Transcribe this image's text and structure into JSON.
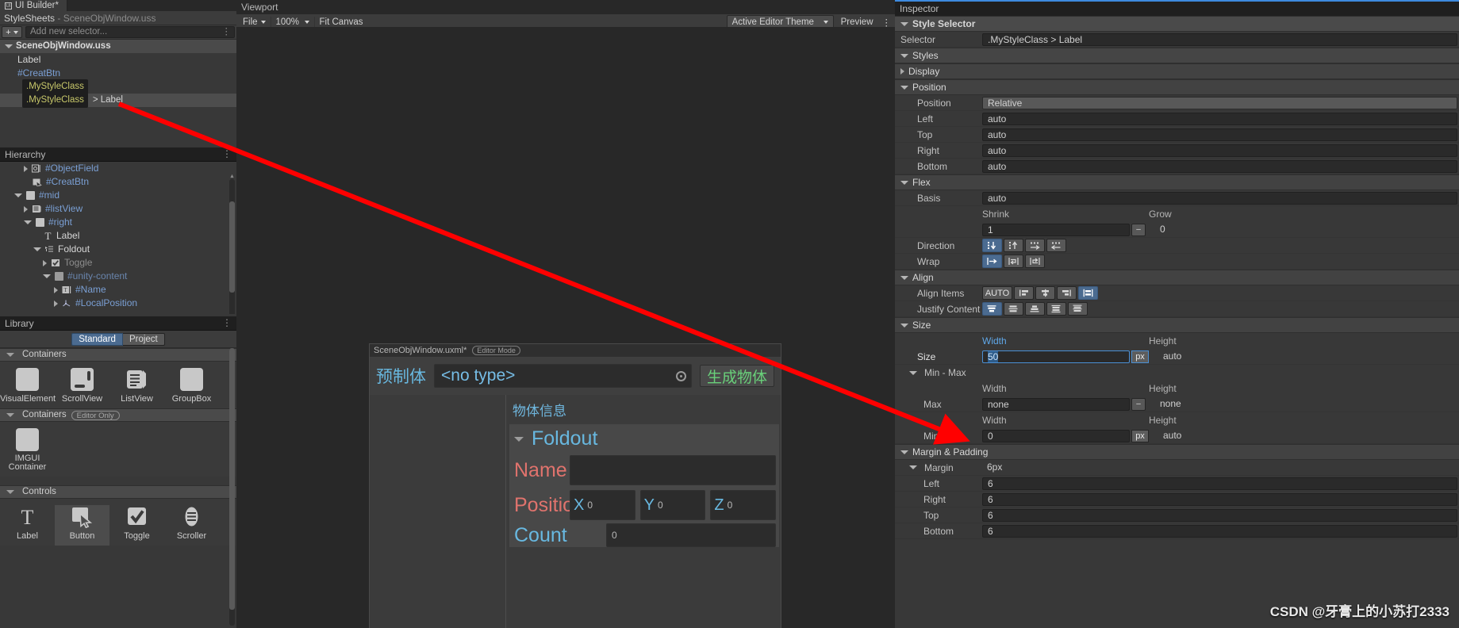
{
  "window": {
    "tab_label": "UI Builder*",
    "tab_icon": "ui-builder-icon"
  },
  "stylesheets": {
    "title": "StyleSheets",
    "subtitle": "- SceneObjWindow.uss",
    "add_button": "+",
    "selector_placeholder": "Add new selector...",
    "root": "SceneObjWindow.uss",
    "rows": [
      {
        "label": "Label",
        "kind": "plain"
      },
      {
        "label": "#CreatBtn",
        "kind": "id"
      },
      {
        "label": ".MyStyleClass",
        "kind": "class"
      },
      {
        "label": ".MyStyleClass",
        "suffix": "> Label",
        "kind": "class-selected"
      }
    ]
  },
  "hierarchy": {
    "title": "Hierarchy",
    "rows": [
      {
        "label": "#ObjectField",
        "indent": 2,
        "expander": "right",
        "icon": "object-field-icon",
        "kind": "id"
      },
      {
        "label": "#CreatBtn",
        "indent": 2,
        "expander": "none",
        "icon": "button-icon",
        "kind": "id"
      },
      {
        "label": "#mid",
        "indent": 1,
        "expander": "down",
        "icon": "visual-element-icon",
        "kind": "id"
      },
      {
        "label": "#listView",
        "indent": 2,
        "expander": "right",
        "icon": "list-view-icon",
        "kind": "id"
      },
      {
        "label": "#right",
        "indent": 2,
        "expander": "down",
        "icon": "visual-element-icon",
        "kind": "id"
      },
      {
        "label": "Label",
        "indent": 3,
        "expander": "none",
        "icon": "label-icon",
        "kind": "plain"
      },
      {
        "label": "Foldout",
        "indent": 3,
        "expander": "down",
        "icon": "foldout-icon",
        "kind": "plain"
      },
      {
        "label": "Toggle",
        "indent": 4,
        "expander": "right",
        "icon": "toggle-icon",
        "kind": "plain"
      },
      {
        "label": "#unity-content",
        "indent": 4,
        "expander": "down",
        "icon": "visual-element-icon",
        "kind": "id"
      },
      {
        "label": "#Name",
        "indent": 5,
        "expander": "right",
        "icon": "text-field-icon",
        "kind": "id"
      },
      {
        "label": "#LocalPosition",
        "indent": 5,
        "expander": "right",
        "icon": "vector3-icon",
        "kind": "id"
      }
    ]
  },
  "library": {
    "title": "Library",
    "tabs": [
      {
        "label": "Standard",
        "active": true
      },
      {
        "label": "Project",
        "active": false
      }
    ],
    "sections": [
      {
        "name": "Containers",
        "editor_only": false,
        "items": [
          {
            "label": "VisualElement",
            "icon": "visual-element-icon",
            "selected": false
          },
          {
            "label": "ScrollView",
            "icon": "scroll-view-icon",
            "selected": false
          },
          {
            "label": "ListView",
            "icon": "list-view-icon",
            "selected": false
          },
          {
            "label": "GroupBox",
            "icon": "group-box-icon",
            "selected": false
          }
        ]
      },
      {
        "name": "Containers",
        "editor_only": true,
        "editor_only_label": "Editor Only",
        "items": [
          {
            "label": "IMGUI Container",
            "icon": "imgui-container-icon",
            "selected": false
          }
        ]
      },
      {
        "name": "Controls",
        "editor_only": false,
        "items": [
          {
            "label": "Label",
            "icon": "label-icon",
            "selected": false
          },
          {
            "label": "Button",
            "icon": "button-icon",
            "selected": true
          },
          {
            "label": "Toggle",
            "icon": "toggle-icon",
            "selected": false
          },
          {
            "label": "Scroller",
            "icon": "scroller-icon",
            "selected": false
          }
        ]
      }
    ]
  },
  "viewport": {
    "title": "Viewport",
    "toolbar": {
      "file_menu": "File",
      "zoom": "100%",
      "fit_canvas": "Fit Canvas",
      "theme": "Active Editor Theme",
      "preview": "Preview",
      "more": "kebab-menu-icon"
    },
    "canvas": {
      "document_name": "SceneObjWindow.uxml*",
      "mode_badge": "Editor Mode",
      "prefab_label": "预制体",
      "object_field_value": "<no type>",
      "create_button": "生成物体",
      "object_info_title": "物体信息",
      "foldout_label": "Foldout",
      "name_label": "Name",
      "name_value": "",
      "position_label": "Position",
      "vector": [
        {
          "axis": "X",
          "value": "0"
        },
        {
          "axis": "Y",
          "value": "0"
        },
        {
          "axis": "Z",
          "value": "0"
        }
      ],
      "count_label": "Count",
      "count_value": "0"
    }
  },
  "inspector": {
    "title": "Inspector",
    "style_selector_section": "Style Selector",
    "selector_label": "Selector",
    "selector_value": ".MyStyleClass > Label",
    "styles_section": "Styles",
    "display_section": "Display",
    "position_section": "Position",
    "position": [
      {
        "label": "Position",
        "value": "Relative",
        "type": "popup"
      },
      {
        "label": "Left",
        "value": "auto",
        "type": "text"
      },
      {
        "label": "Top",
        "value": "auto",
        "type": "text"
      },
      {
        "label": "Right",
        "value": "auto",
        "type": "text"
      },
      {
        "label": "Bottom",
        "value": "auto",
        "type": "text"
      }
    ],
    "flex_section": "Flex",
    "flex": {
      "basis_label": "Basis",
      "basis_value": "auto",
      "shrink_label": "Shrink",
      "shrink_value": "1",
      "grow_label": "Grow",
      "grow_value": "0",
      "direction_label": "Direction",
      "direction_buttons": [
        "column-icon",
        "column-reverse-icon",
        "row-icon",
        "row-reverse-icon"
      ],
      "direction_active": 0,
      "wrap_label": "Wrap",
      "wrap_buttons": [
        "nowrap-icon",
        "wrap-icon",
        "wrap-reverse-icon"
      ],
      "wrap_active": 0
    },
    "align_section": "Align",
    "align": {
      "align_items_label": "Align Items",
      "align_items_auto": "AUTO",
      "align_items_buttons": [
        "align-start-icon",
        "align-center-icon",
        "align-end-icon",
        "align-stretch-icon"
      ],
      "align_items_active": 3,
      "justify_content_label": "Justify Content",
      "justify_content_buttons": [
        "justify-start-icon",
        "justify-center-icon",
        "justify-end-icon",
        "justify-space-between-icon",
        "justify-space-around-icon"
      ],
      "justify_content_active": 0
    },
    "size_section": "Size",
    "size": {
      "width_header": "Width",
      "height_header": "Height",
      "size_label": "Size",
      "width_value": "50",
      "width_unit": "px",
      "height_value": "auto",
      "minmax_label": "Min - Max",
      "max_label": "Max",
      "max_width_header": "Width",
      "max_height_header": "Height",
      "max_width_value": "none",
      "max_height_value": "none",
      "min_label": "Min",
      "min_width_header": "Width",
      "min_height_header": "Height",
      "min_width_value": "0",
      "min_width_unit": "px",
      "min_height_value": "auto"
    },
    "margin_padding_section": "Margin & Padding",
    "margin": {
      "label": "Margin",
      "value": "6px",
      "rows": [
        {
          "label": "Left",
          "value": "6"
        },
        {
          "label": "Right",
          "value": "6"
        },
        {
          "label": "Top",
          "value": "6"
        },
        {
          "label": "Bottom",
          "value": "6"
        }
      ]
    }
  },
  "annotation": {
    "watermark": "CSDN @牙膏上的小苏打2333",
    "arrow_color": "#ff0000"
  }
}
